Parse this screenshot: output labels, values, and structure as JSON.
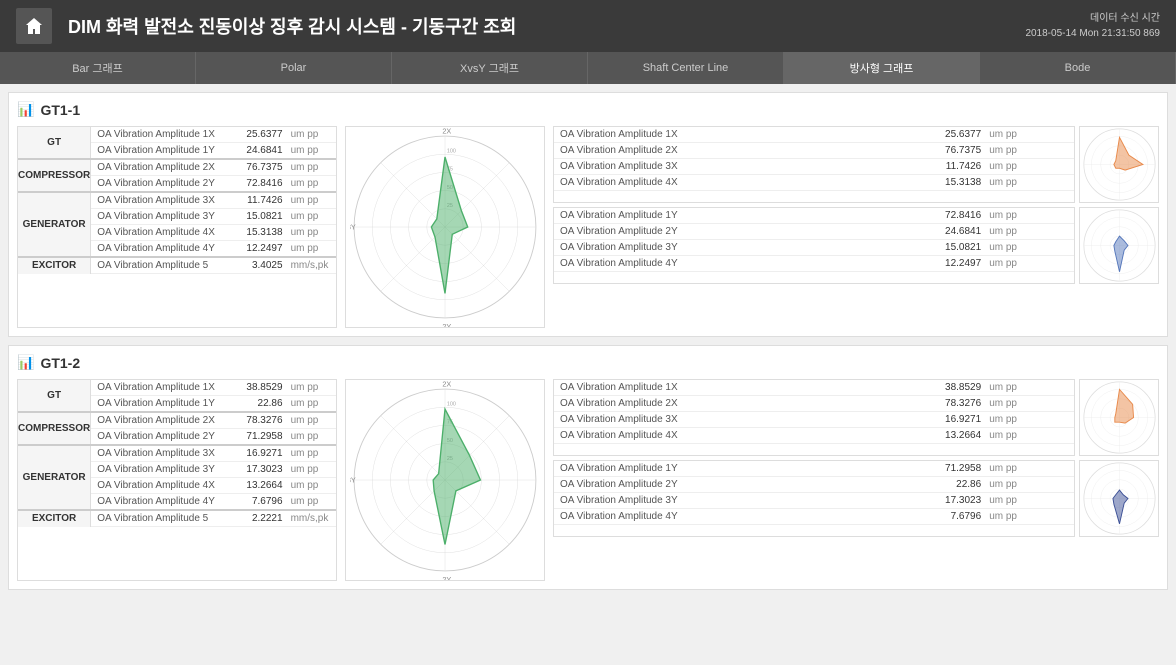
{
  "header": {
    "title": "DIM  화력 발전소 진동이상 징후 감시 시스템 - 기동구간 조회",
    "time_label": "데이터 수신 시간",
    "time_value": "2018-05-14 Mon 21:31:50 869"
  },
  "nav": {
    "tabs": [
      {
        "label": "Bar 그래프",
        "active": false
      },
      {
        "label": "Polar",
        "active": false
      },
      {
        "label": "XvsY 그래프",
        "active": false
      },
      {
        "label": "Shaft Center Line",
        "active": false
      },
      {
        "label": "방사형 그래프",
        "active": true
      },
      {
        "label": "Bode",
        "active": false
      }
    ]
  },
  "gt1": {
    "title": "GT1-1",
    "left": {
      "rows": [
        {
          "label": "GT",
          "params": [
            {
              "name": "OA Vibration Amplitude 1X",
              "value": "25.6377",
              "unit": "um pp"
            },
            {
              "name": "OA Vibration Amplitude 1Y",
              "value": "24.6841",
              "unit": "um pp"
            }
          ]
        },
        {
          "label": "COMPRESSOR",
          "params": [
            {
              "name": "OA Vibration Amplitude 2X",
              "value": "76.7375",
              "unit": "um pp"
            },
            {
              "name": "OA Vibration Amplitude 2Y",
              "value": "72.8416",
              "unit": "um pp"
            }
          ]
        },
        {
          "label": "GENERATOR",
          "params": [
            {
              "name": "OA Vibration Amplitude 3X",
              "value": "11.7426",
              "unit": "um pp"
            },
            {
              "name": "OA Vibration Amplitude 3Y",
              "value": "15.0821",
              "unit": "um pp"
            },
            {
              "name": "OA Vibration Amplitude 4X",
              "value": "15.3138",
              "unit": "um pp"
            },
            {
              "name": "OA Vibration Amplitude 4Y",
              "value": "12.2497",
              "unit": "um pp"
            }
          ]
        },
        {
          "label": "EXCITOR",
          "params": [
            {
              "name": "OA Vibration Amplitude 5",
              "value": "3.4025",
              "unit": "mm/s,pk"
            }
          ]
        }
      ]
    },
    "right_x": {
      "title": "OA Vibration Amplitude",
      "rows": [
        {
          "name": "OA Vibration Amplitude 1X",
          "value": "25.6377",
          "unit": "um pp"
        },
        {
          "name": "OA Vibration Amplitude 2X",
          "value": "76.7375",
          "unit": "um pp"
        },
        {
          "name": "OA Vibration Amplitude 3X",
          "value": "11.7426",
          "unit": "um pp"
        },
        {
          "name": "OA Vibration Amplitude 4X",
          "value": "15.3138",
          "unit": "um pp"
        }
      ]
    },
    "right_y": {
      "title": "OA Vibration Amplitude",
      "rows": [
        {
          "name": "OA Vibration Amplitude 1Y",
          "value": "72.8416",
          "unit": "um pp"
        },
        {
          "name": "OA Vibration Amplitude 2Y",
          "value": "24.6841",
          "unit": "um pp"
        },
        {
          "name": "OA Vibration Amplitude 3Y",
          "value": "15.0821",
          "unit": "um pp"
        },
        {
          "name": "OA Vibration Amplitude 4Y",
          "value": "12.2497",
          "unit": "um pp"
        }
      ]
    }
  },
  "gt2": {
    "title": "GT1-2",
    "left": {
      "rows": [
        {
          "label": "GT",
          "params": [
            {
              "name": "OA Vibration Amplitude 1X",
              "value": "38.8529",
              "unit": "um pp"
            },
            {
              "name": "OA Vibration Amplitude 1Y",
              "value": "22.86",
              "unit": "um pp"
            }
          ]
        },
        {
          "label": "COMPRESSOR",
          "params": [
            {
              "name": "OA Vibration Amplitude 2X",
              "value": "78.3276",
              "unit": "um pp"
            },
            {
              "name": "OA Vibration Amplitude 2Y",
              "value": "71.2958",
              "unit": "um pp"
            }
          ]
        },
        {
          "label": "GENERATOR",
          "params": [
            {
              "name": "OA Vibration Amplitude 3X",
              "value": "16.9271",
              "unit": "um pp"
            },
            {
              "name": "OA Vibration Amplitude 3Y",
              "value": "17.3023",
              "unit": "um pp"
            },
            {
              "name": "OA Vibration Amplitude 4X",
              "value": "13.2664",
              "unit": "um pp"
            },
            {
              "name": "OA Vibration Amplitude 4Y",
              "value": "7.6796",
              "unit": "um pp"
            }
          ]
        },
        {
          "label": "EXCITOR",
          "params": [
            {
              "name": "OA Vibration Amplitude 5",
              "value": "2.2221",
              "unit": "mm/s,pk"
            }
          ]
        }
      ]
    },
    "right_x": {
      "title": "OA Vibration Amplitude",
      "rows": [
        {
          "name": "OA Vibration Amplitude 1X",
          "value": "38.8529",
          "unit": "um pp"
        },
        {
          "name": "OA Vibration Amplitude 2X",
          "value": "78.3276",
          "unit": "um pp"
        },
        {
          "name": "OA Vibration Amplitude 3X",
          "value": "16.9271",
          "unit": "um pp"
        },
        {
          "name": "OA Vibration Amplitude 4X",
          "value": "13.2664",
          "unit": "um pp"
        }
      ]
    },
    "right_y": {
      "title": "OA Vibration Amplitude",
      "rows": [
        {
          "name": "OA Vibration Amplitude 1Y",
          "value": "71.2958",
          "unit": "um pp"
        },
        {
          "name": "OA Vibration Amplitude 2Y",
          "value": "22.86",
          "unit": "um pp"
        },
        {
          "name": "OA Vibration Amplitude 3Y",
          "value": "17.3023",
          "unit": "um pp"
        },
        {
          "name": "OA Vibration Amplitude 4Y",
          "value": "7.6796",
          "unit": "um pp"
        }
      ]
    }
  },
  "colors": {
    "header_bg": "#3a3a3a",
    "nav_bg": "#555555",
    "nav_active": "#666666",
    "accent_green": "#4caf6a",
    "accent_orange": "#e8894a",
    "accent_blue": "#5577bb"
  }
}
